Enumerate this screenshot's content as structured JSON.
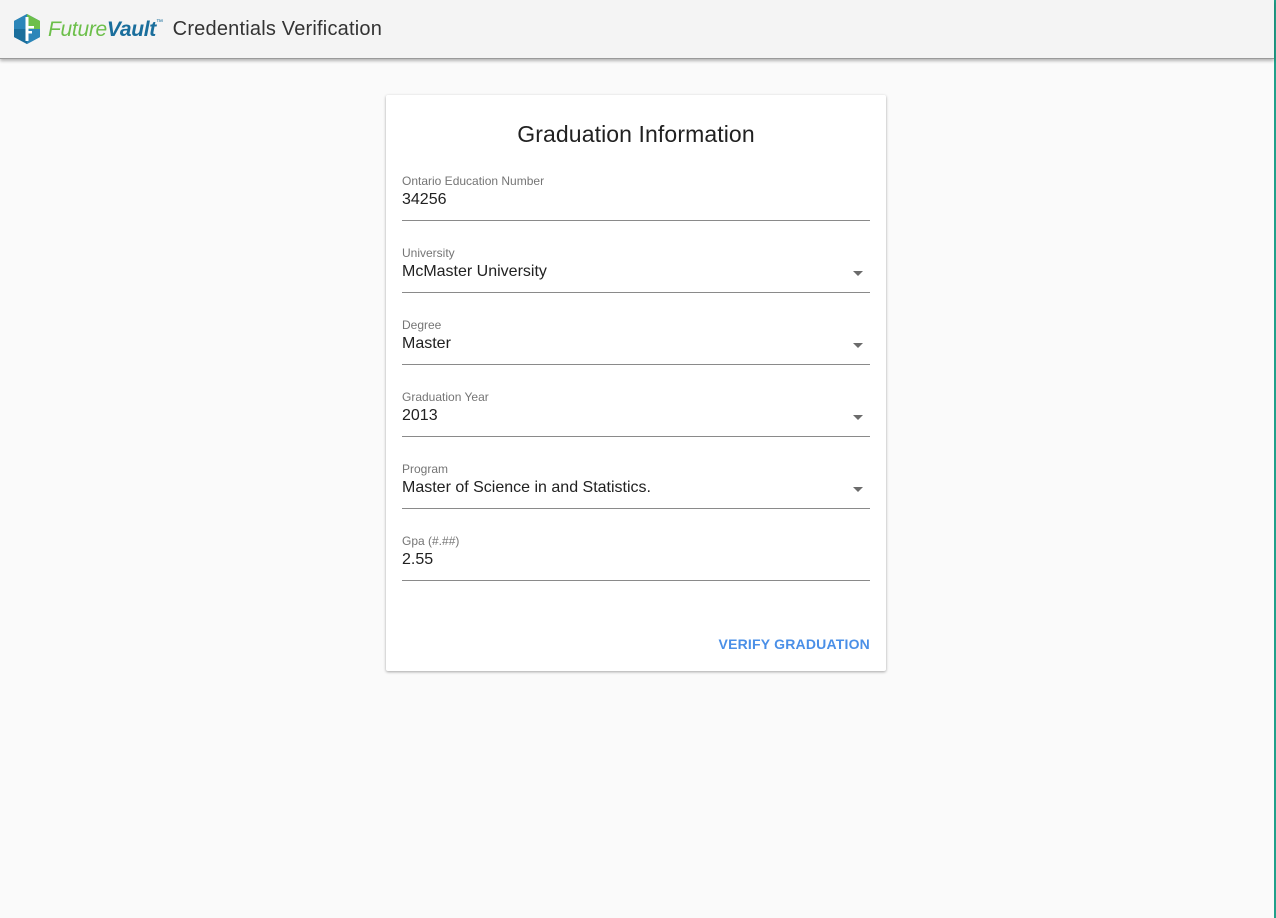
{
  "app": {
    "brand_light": "Future",
    "brand_bold": "Vault",
    "brand_tm": "™",
    "title": "Credentials Verification"
  },
  "form": {
    "title": "Graduation Information",
    "fields": [
      {
        "label": "Ontario Education Number",
        "value": "34256",
        "type": "text"
      },
      {
        "label": "University",
        "value": "McMaster University",
        "type": "select"
      },
      {
        "label": "Degree",
        "value": "Master",
        "type": "select"
      },
      {
        "label": "Graduation Year",
        "value": "2013",
        "type": "select"
      },
      {
        "label": "Program",
        "value": "Master of Science in and Statistics.",
        "type": "select"
      },
      {
        "label": "Gpa (#.##)",
        "value": "2.55",
        "type": "text"
      }
    ],
    "submit_label": "VERIFY GRADUATION"
  },
  "colors": {
    "accent": "#4a8fe7",
    "brand_green": "#6cbf4a",
    "brand_blue": "#1a6e9c",
    "edge": "#21a08a"
  },
  "icons": {
    "logo": "futurevault-logo-icon",
    "dropdown": "caret-down-icon"
  }
}
